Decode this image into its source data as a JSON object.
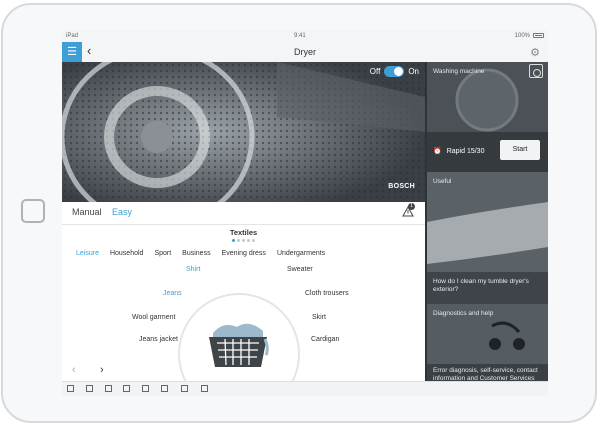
{
  "statusbar": {
    "carrier": "iPad",
    "time": "9:41",
    "battery": "100%"
  },
  "nav": {
    "title": "Dryer"
  },
  "power": {
    "off_label": "Off",
    "on_label": "On",
    "state": "on"
  },
  "brand": "BOSCH",
  "modes": {
    "manual": "Manual",
    "easy": "Easy",
    "selected": "Easy",
    "notification_count": "1"
  },
  "section": {
    "title": "Textiles",
    "page_dots": 5,
    "active_dot": 1
  },
  "categories": [
    "Leisure",
    "Household",
    "Sport",
    "Business",
    "Evening dress",
    "Undergarments"
  ],
  "selected_category": "Leisure",
  "garments": {
    "left": [
      "Shirt",
      "Jeans",
      "Wool garment",
      "Jeans jacket"
    ],
    "right": [
      "Sweater",
      "Cloth trousers",
      "Skirt",
      "Cardigan"
    ],
    "selected": [
      "Shirt",
      "Jeans"
    ]
  },
  "sidebar": {
    "washing_machine": "Washing machine",
    "program": "Rapid 15/30",
    "start": "Start",
    "useful": "Useful",
    "useful_question": "How do I clean my tumble dryer's exterior?",
    "diagnostics": "Diagnostics and help",
    "diagnostics_desc": "Error diagnosis, self-service, contact information and Customer Services"
  },
  "icons": {
    "menu": "hamburger-icon",
    "back": "chevron-left-icon",
    "settings": "gear-icon",
    "warning": "warning-icon",
    "clock": "clock-icon",
    "washing_machine": "washing-machine-icon",
    "basket": "laundry-basket-icon"
  },
  "colors": {
    "accent": "#3d9fd6",
    "sidebar": "#3c4248"
  }
}
